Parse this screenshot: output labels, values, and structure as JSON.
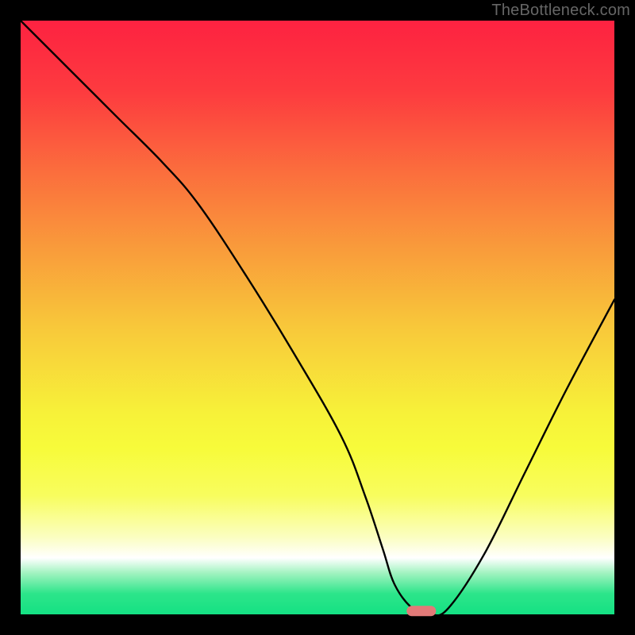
{
  "watermark": "TheBottleneck.com",
  "colors": {
    "black": "#000000",
    "curve": "#000000",
    "marker": "#e27a78",
    "gradient_stops": [
      {
        "offset": 0.0,
        "color": "#fd2241"
      },
      {
        "offset": 0.12,
        "color": "#fd3b3f"
      },
      {
        "offset": 0.25,
        "color": "#fb6c3d"
      },
      {
        "offset": 0.38,
        "color": "#f99a3b"
      },
      {
        "offset": 0.52,
        "color": "#f8c93a"
      },
      {
        "offset": 0.66,
        "color": "#f7f139"
      },
      {
        "offset": 0.72,
        "color": "#f7fb3a"
      },
      {
        "offset": 0.8,
        "color": "#f8fd5e"
      },
      {
        "offset": 0.87,
        "color": "#fbfec1"
      },
      {
        "offset": 0.905,
        "color": "#ffffff"
      },
      {
        "offset": 0.93,
        "color": "#a3f3c1"
      },
      {
        "offset": 0.965,
        "color": "#2de58a"
      },
      {
        "offset": 1.0,
        "color": "#14e183"
      }
    ]
  },
  "chart_data": {
    "type": "line",
    "title": "",
    "xlabel": "",
    "ylabel": "",
    "xlim": [
      0,
      100
    ],
    "ylim": [
      0,
      100
    ],
    "grid": false,
    "legend": false,
    "x": [
      0,
      8,
      16,
      24,
      30,
      38,
      46,
      54,
      58,
      61,
      63,
      66,
      69,
      72,
      78,
      85,
      92,
      100
    ],
    "values": [
      100,
      92,
      84,
      76,
      69,
      57,
      44,
      30,
      20,
      11,
      5,
      1,
      0,
      1,
      10,
      24,
      38,
      53
    ],
    "marker": {
      "x": 67.5,
      "y": 0.6,
      "w": 5,
      "h": 1.8
    }
  }
}
